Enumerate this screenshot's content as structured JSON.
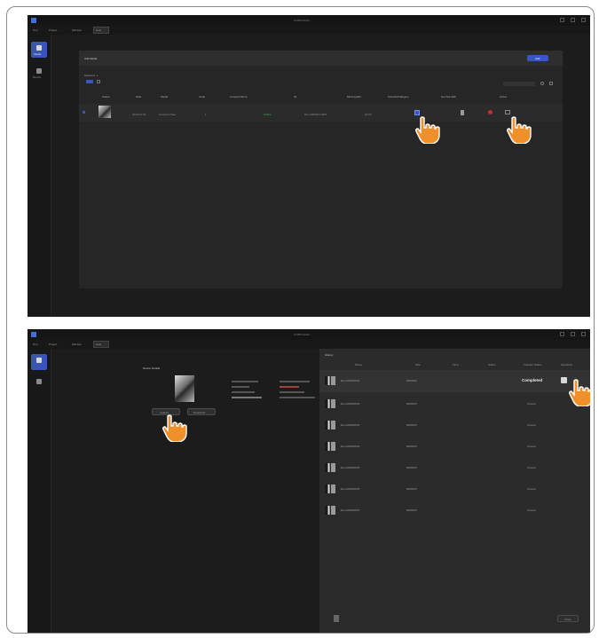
{
  "top_panel": {
    "window_title": "OOBS Media",
    "menu_items": [
      "Tool",
      "Project",
      "Window",
      "Help"
    ],
    "sidebar_items": [
      {
        "label": "Media",
        "icon": "media-icon"
      },
      {
        "label": "Device",
        "icon": "device-icon"
      }
    ],
    "card_title": "Add Media",
    "add_button": "Add",
    "filter_label": "Selected: 1",
    "columns": [
      "Status",
      "Date",
      "Model",
      "Code",
      "Camera Name",
      "ID",
      "Moving Edit",
      "Favorite/Category",
      "Net Sub Edit",
      "Action"
    ],
    "row": {
      "date": "2020-01-01",
      "model": "Camera Video",
      "code": "1",
      "camera": "Online",
      "id": "Rec-0000001-0001",
      "edit": "01:00"
    }
  },
  "bottom_panel": {
    "window_title": "OOBS Media",
    "preview_title": "Device Details",
    "preview_buttons": [
      "Upload",
      "Download"
    ],
    "list_title": "History",
    "list_columns": [
      "Name",
      "Size",
      "Time",
      "Status",
      "Transfer Status",
      "Operation"
    ],
    "rows": [
      {
        "name": "Rec-000000001",
        "size": "0000000",
        "status": "Completed"
      },
      {
        "name": "Rec-000000002",
        "size": "0000000",
        "status": "Upload"
      },
      {
        "name": "Rec-000000003",
        "size": "0000000",
        "status": "Upload"
      },
      {
        "name": "Rec-000000004",
        "size": "0000000",
        "status": "Upload"
      },
      {
        "name": "Rec-000000005",
        "size": "0000000",
        "status": "Upload"
      },
      {
        "name": "Rec-000000006",
        "size": "0000000",
        "status": "Upload"
      },
      {
        "name": "Rec-000000007",
        "size": "0000000",
        "status": "Upload"
      }
    ],
    "footer_button": "Close"
  },
  "colors": {
    "accent": "#3a56c5",
    "panel_bg": "#1c1c1c",
    "card_bg": "#262626",
    "hand_orange": "#f0902a"
  }
}
